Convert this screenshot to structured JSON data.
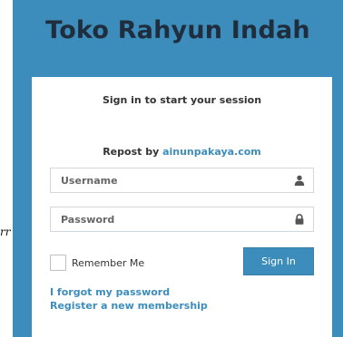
{
  "brand": {
    "title": "Toko Rahyun Indah",
    "accent_color": "#3c8dbc"
  },
  "login": {
    "session_message": "Sign in to start your session",
    "repost_prefix": "Repost by ",
    "repost_link": "ainunpakaya.com",
    "username_placeholder": "Username",
    "username_icon": "user-icon",
    "password_placeholder": "Password",
    "password_icon": "lock-icon",
    "remember_label": "Remember Me",
    "signin_label": "Sign In",
    "forgot_link": "I forgot my password",
    "register_link": "Register a new membership"
  },
  "edge_fragment": "rr"
}
